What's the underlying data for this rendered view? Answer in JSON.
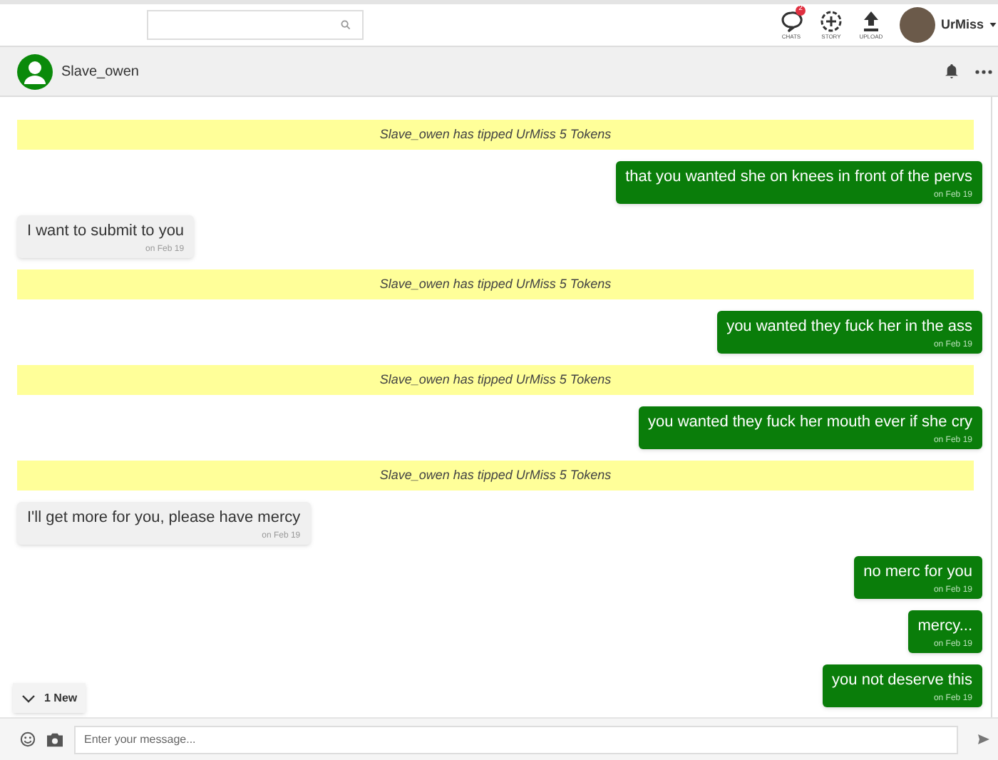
{
  "topbar": {
    "nav": [
      {
        "label": "CHATS",
        "kind": "chats",
        "badge": "2"
      },
      {
        "label": "STORY",
        "kind": "story"
      },
      {
        "label": "UPLOAD",
        "kind": "upload"
      }
    ],
    "user": "UrMiss"
  },
  "chat_header": {
    "name": "Slave_owen"
  },
  "messages": [
    {
      "kind": "tip",
      "text": "Slave_owen has tipped UrMiss 5 Tokens"
    },
    {
      "kind": "out",
      "text": "that you wanted she on knees in front of the pervs",
      "date": "on Feb 19"
    },
    {
      "kind": "in",
      "text": "I want to submit to you",
      "date": "on Feb 19"
    },
    {
      "kind": "tip",
      "text": "Slave_owen has tipped UrMiss 5 Tokens"
    },
    {
      "kind": "out",
      "text": "you wanted they fuck her in the ass",
      "date": "on Feb 19"
    },
    {
      "kind": "tip",
      "text": "Slave_owen has tipped UrMiss 5 Tokens"
    },
    {
      "kind": "out",
      "text": "you wanted they fuck her mouth ever if she cry",
      "date": "on Feb 19"
    },
    {
      "kind": "tip",
      "text": "Slave_owen has tipped UrMiss 5 Tokens"
    },
    {
      "kind": "in",
      "text": "I'll get more for you, please have mercy",
      "date": "on Feb 19"
    },
    {
      "kind": "out",
      "text": "no merc for you",
      "date": "on Feb 19"
    },
    {
      "kind": "out",
      "text": "mercy...",
      "date": "on Feb 19"
    },
    {
      "kind": "out",
      "text": "you not deserve this",
      "date": "on Feb 19"
    }
  ],
  "new_button": {
    "label": "1 New"
  },
  "composer": {
    "placeholder": "Enter your message..."
  }
}
